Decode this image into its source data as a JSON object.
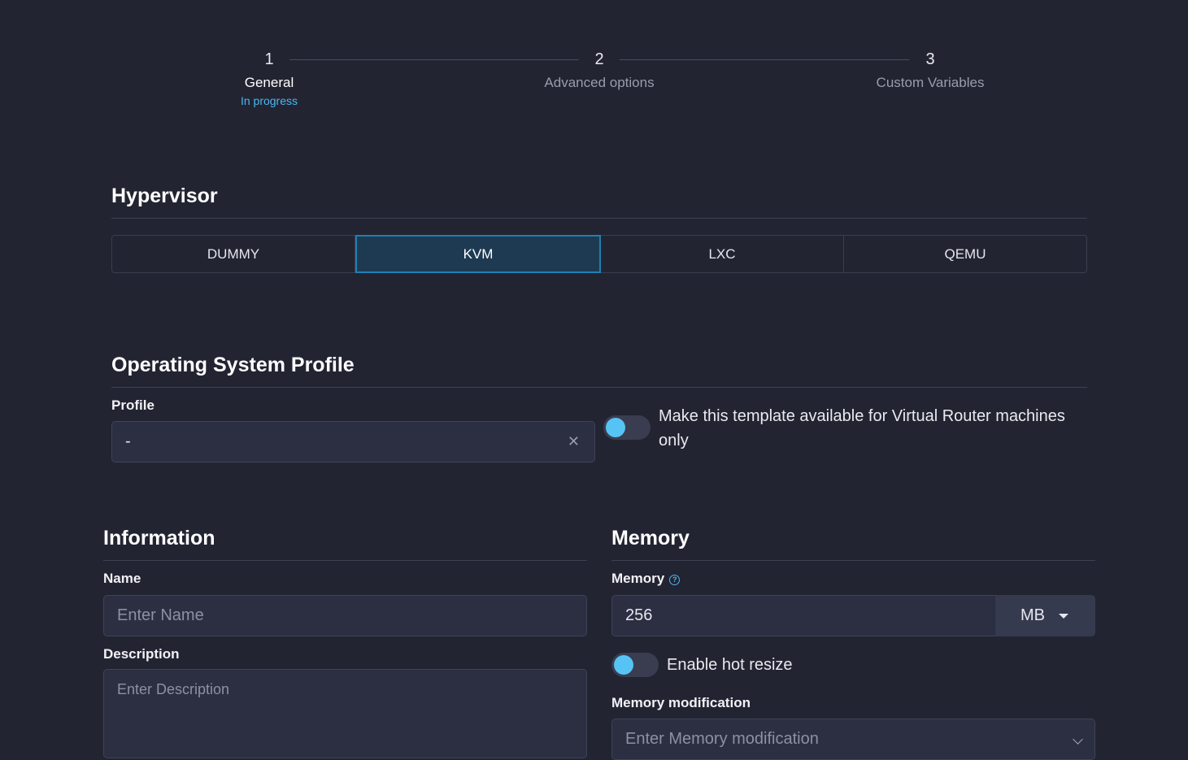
{
  "stepper": [
    {
      "num": "1",
      "label": "General",
      "status": "In progress"
    },
    {
      "num": "2",
      "label": "Advanced options"
    },
    {
      "num": "3",
      "label": "Custom Variables"
    }
  ],
  "hypervisor": {
    "title": "Hypervisor",
    "options": [
      "DUMMY",
      "KVM",
      "LXC",
      "QEMU"
    ],
    "selected": "KVM"
  },
  "os_profile": {
    "title": "Operating System Profile",
    "profile_label": "Profile",
    "profile_value": "-",
    "vrouter_toggle_label": "Make this template available for Virtual Router machines only"
  },
  "information": {
    "title": "Information",
    "name_label": "Name",
    "name_placeholder": "Enter Name",
    "description_label": "Description",
    "description_placeholder": "Enter Description"
  },
  "memory": {
    "title": "Memory",
    "memory_label": "Memory",
    "memory_value": "256",
    "unit": "MB",
    "hot_resize_label": "Enable hot resize",
    "modification_label": "Memory modification",
    "modification_placeholder": "Enter Memory modification"
  },
  "colors": {
    "accent": "#4ab8f0",
    "selected_bg": "#1d3a52",
    "background": "#222432"
  }
}
